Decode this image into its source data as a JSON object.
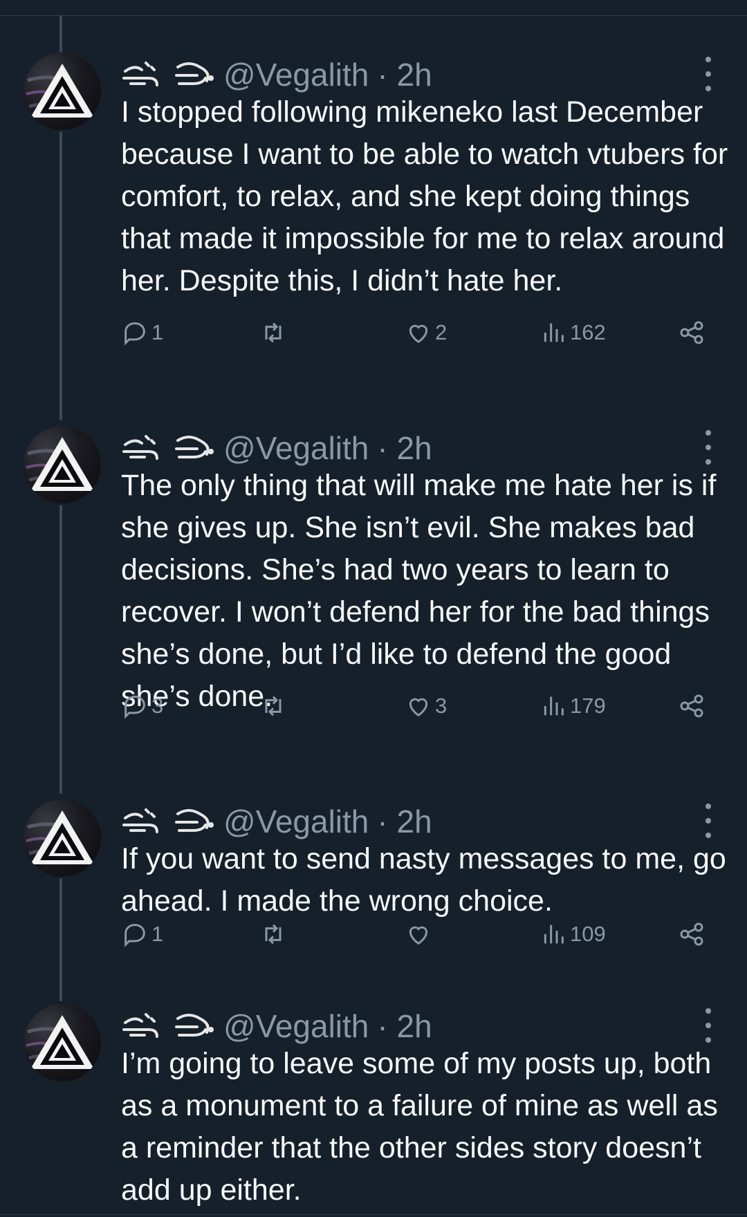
{
  "colors": {
    "background": "#15202b",
    "text": "#f7f9f9",
    "muted": "#8b98a5",
    "thread_line": "#3d4a57"
  },
  "tweets": [
    {
      "handle": "@Vegalith",
      "time": "· 2h",
      "text": "I stopped following mikeneko last December because I want to be able to watch vtubers for comfort, to relax, and she kept doing things that made it impossible for me to relax around her. Despite this, I didn’t hate her.",
      "replies": "1",
      "reposts": "",
      "likes": "2",
      "views": "162",
      "icons": [
        "reply-icon",
        "repost-icon",
        "like-icon",
        "views-icon",
        "share-icon"
      ]
    },
    {
      "handle": "@Vegalith",
      "time": "· 2h",
      "text": "The only thing that will make me hate her is if she gives up. She isn’t evil. She makes bad decisions. She’s had two years to learn to recover. I won’t defend her for the bad things she’s done, but I’d like to defend the good she’s done.",
      "replies": "3",
      "reposts": "",
      "likes": "3",
      "views": "179"
    },
    {
      "handle": "@Vegalith",
      "time": "· 2h",
      "text": "If you want to send nasty messages to me, go ahead. I made the wrong choice.",
      "replies": "1",
      "reposts": "",
      "likes": "",
      "views": "109"
    },
    {
      "handle": "@Vegalith",
      "time": "· 2h",
      "text": "I’m going to leave some of my posts up, both as a monument to a failure of mine as well as a reminder that the other sides story doesn’t add up either."
    }
  ]
}
